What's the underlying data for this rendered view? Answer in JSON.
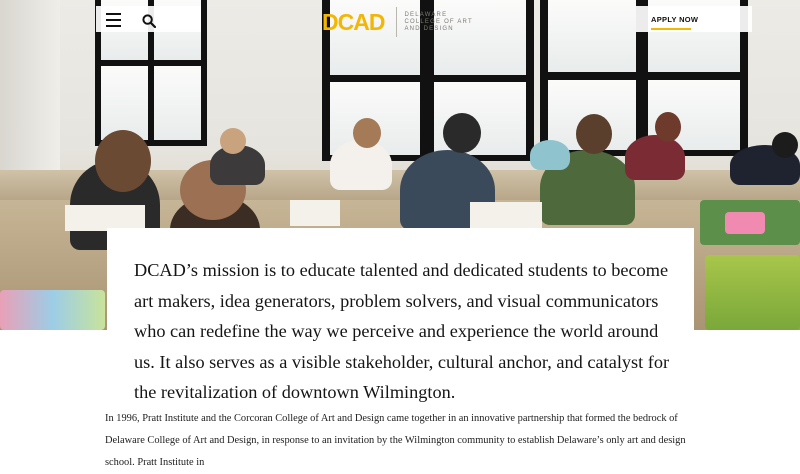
{
  "header": {
    "menu_icon": "hamburger-menu-icon",
    "search_icon": "search-icon",
    "logo_mark": "DCAD",
    "logo_text_lines": [
      "DELAWARE",
      "COLLEGE OF ART",
      "AND DESIGN"
    ],
    "apply_label": "APPLY NOW",
    "accent_color": "#f2b705"
  },
  "hero": {
    "photo_alt": "Students drawing at tables in a studio classroom"
  },
  "mission": {
    "text": "DCAD’s mission is to educate talented and dedicated students to become art makers, idea generators, problem solvers, and visual communicators who can redefine the way we perceive and experience the world around us. It also serves as a visible stakeholder, cultural anchor, and catalyst for the revitalization of downtown Wilmington."
  },
  "history": {
    "text": "In 1996, Pratt Institute and the Corcoran College of Art and Design came together in an innovative partnership that formed the bedrock of Delaware College of Art and Design, in response to an invitation by the Wilmington community to establish Delaware’s only art and design school. Pratt Institute in"
  }
}
